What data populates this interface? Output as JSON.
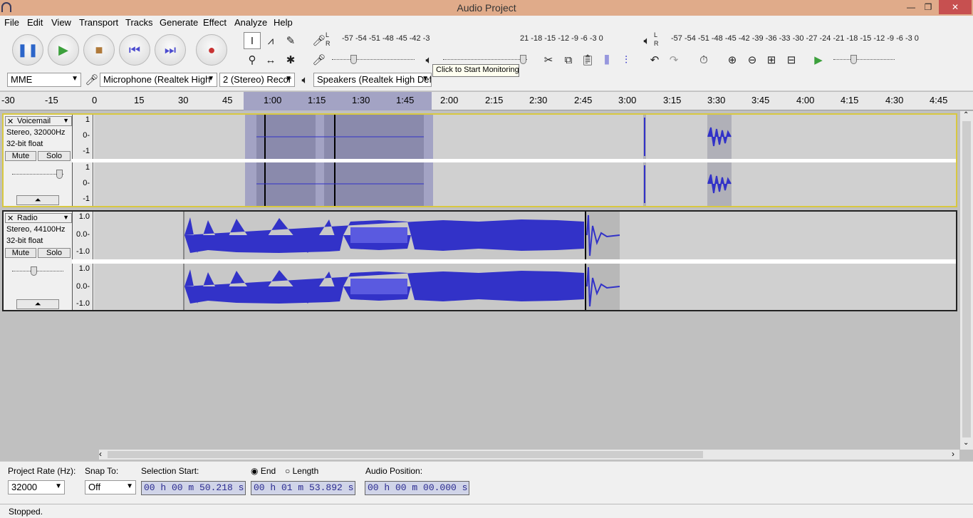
{
  "window": {
    "title": "Audio Project",
    "min": "—",
    "max": "❐",
    "close": "✕"
  },
  "menu": [
    "File",
    "Edit",
    "View",
    "Transport",
    "Tracks",
    "Generate",
    "Effect",
    "Analyze",
    "Help"
  ],
  "transport": {
    "pause": "❚❚",
    "play": "▶",
    "stop": "■",
    "skip_start": "⏮",
    "skip_end": "⏭",
    "record": "●"
  },
  "meters": {
    "record_scale": "-57 -54 -51 -48 -45 -42 -3",
    "record_scale_tail": "21 -18 -15 -12  -9  -6  -3  0",
    "tooltip": "Click to Start Monitoring",
    "play_scale": "-57 -54 -51 -48 -45 -42 -39 -36 -33 -30 -27 -24 -21 -18 -15 -12  -9  -6  -3  0",
    "lr_top": "L",
    "lr_bottom": "R",
    "slider_minus": "-",
    "slider_plus": "+"
  },
  "device": {
    "host": "MME",
    "input": "Microphone (Realtek High",
    "channels": "2 (Stereo) Recor",
    "output": "Speakers (Realtek High Def"
  },
  "ruler": [
    "-30",
    "-15",
    "0",
    "15",
    "30",
    "45",
    "1:00",
    "1:15",
    "1:30",
    "1:45",
    "2:00",
    "2:15",
    "2:30",
    "2:45",
    "3:00",
    "3:15",
    "3:30",
    "3:45",
    "4:00",
    "4:15",
    "4:30",
    "4:45"
  ],
  "selection": {
    "start_fraction": 0.2581,
    "end_fraction": 0.4513
  },
  "tracks": [
    {
      "name": "Voicemail",
      "format": "Stereo, 32000Hz",
      "depth": "32-bit float",
      "mute": "Mute",
      "solo": "Solo",
      "scale": [
        "1",
        "0-",
        "-1"
      ]
    },
    {
      "name": "Radio",
      "format": "Stereo, 44100Hz",
      "depth": "32-bit float",
      "mute": "Mute",
      "solo": "Solo",
      "scale": [
        "1.0",
        "0.0-",
        "-1.0"
      ]
    }
  ],
  "bottom": {
    "rate_label": "Project Rate (Hz):",
    "rate": "32000",
    "snap_label": "Snap To:",
    "snap": "Off",
    "sel_label": "Selection Start:",
    "sel_start": "00 h 00 m 50.218 s",
    "end_label": "End",
    "length_label": "Length",
    "sel_end": "00 h 01 m 53.892 s",
    "pos_label": "Audio Position:",
    "pos": "00 h 00 m 00.000 s"
  },
  "status": "Stopped.",
  "colors": {
    "wave": "#3232c8",
    "selection": "#a3a3c4",
    "titlebar": "#e0ab8a"
  }
}
